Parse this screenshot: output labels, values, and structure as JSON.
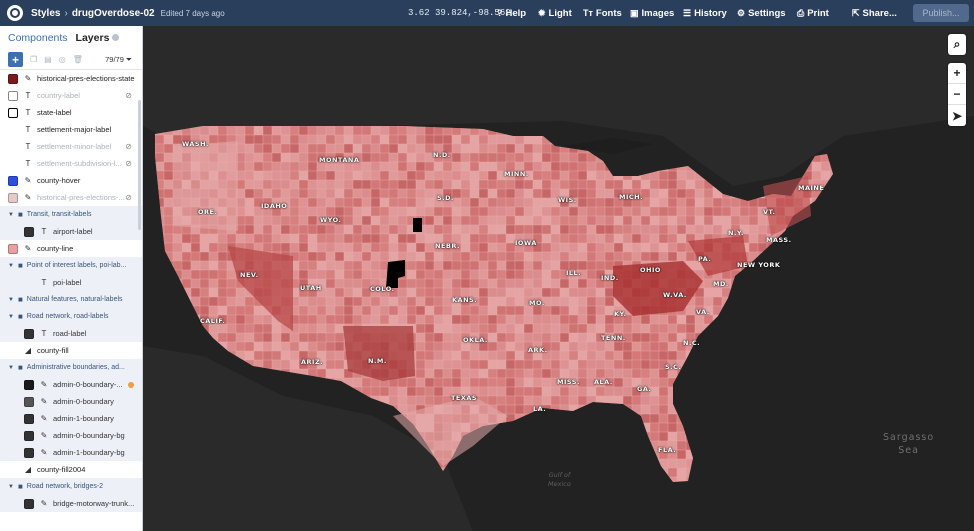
{
  "header": {
    "styles": "Styles",
    "style_name": "drugOverdose-02",
    "edited": "Edited 7 days ago",
    "coords": "3.62 39.824,-98.562",
    "menu": [
      {
        "icon": "help-icon",
        "glyph": "?",
        "label": "Help"
      },
      {
        "icon": "light-icon",
        "glyph": "✹",
        "label": "Light"
      },
      {
        "icon": "fonts-icon",
        "glyph": "Tт",
        "label": "Fonts"
      },
      {
        "icon": "images-icon",
        "glyph": "▣",
        "label": "Images"
      },
      {
        "icon": "history-icon",
        "glyph": "☰",
        "label": "History"
      },
      {
        "icon": "settings-icon",
        "glyph": "⚙",
        "label": "Settings"
      },
      {
        "icon": "print-icon",
        "glyph": "⎙",
        "label": "Print"
      },
      {
        "icon": "share-icon",
        "glyph": "⇱",
        "label": "Share..."
      }
    ],
    "publish": "Publish..."
  },
  "sidebar": {
    "tab_components": "Components",
    "tab_layers": "Layers",
    "count": "79/79",
    "layers": [
      {
        "kind": "layer",
        "swatch": "#7a1a1a",
        "type": "✎",
        "label": "historical-pres-elections-state",
        "dim": false
      },
      {
        "kind": "layer",
        "swatch": "#ffffff",
        "swatch_border": "#888",
        "type": "T",
        "label": "country-label",
        "dim": true,
        "hidden": true
      },
      {
        "kind": "layer",
        "swatch": "#ffffff",
        "swatch_border": "#000",
        "type": "T",
        "label": "state-label",
        "dim": false
      },
      {
        "kind": "layer",
        "swatch": "none",
        "type": "T",
        "label": "settlement-major-label",
        "dim": false
      },
      {
        "kind": "layer",
        "swatch": "none",
        "type": "T",
        "label": "settlement-minor-label",
        "dim": true,
        "hidden": true
      },
      {
        "kind": "layer",
        "swatch": "none",
        "type": "T",
        "label": "settlement-subdivision-l...",
        "dim": true,
        "hidden": true
      },
      {
        "kind": "layer",
        "swatch": "#2d4fe0",
        "type": "✎",
        "label": "county-hover",
        "dim": false
      },
      {
        "kind": "layer",
        "swatch": "#e6c8c8",
        "type": "✎",
        "label": "historical-pres-elections-...",
        "dim": true,
        "hidden": true
      },
      {
        "kind": "group",
        "label": "Transit, transit-labels"
      },
      {
        "kind": "child",
        "swatch": "#333",
        "type": "T",
        "label": "airport-label"
      },
      {
        "kind": "layer",
        "swatch": "#e8a0a0",
        "type": "✎",
        "label": "county-line",
        "dim": false
      },
      {
        "kind": "group",
        "label": "Point of interest labels, poi-lab..."
      },
      {
        "kind": "child",
        "swatch": "none",
        "type": "T",
        "label": "poi-label"
      },
      {
        "kind": "group",
        "label": "Natural features, natural-labels"
      },
      {
        "kind": "group",
        "label": "Road network, road-labels"
      },
      {
        "kind": "child",
        "swatch": "#333",
        "type": "T",
        "label": "road-label"
      },
      {
        "kind": "layer",
        "swatch": "none",
        "type": "◢",
        "label": "county-fill",
        "dim": false
      },
      {
        "kind": "group",
        "label": "Administrative boundaries, ad..."
      },
      {
        "kind": "child",
        "swatch": "#1a1a1a",
        "type": "✎",
        "label": "admin-0-boundary-...",
        "warn": true
      },
      {
        "kind": "child",
        "swatch": "#555",
        "type": "✎",
        "label": "admin-0-boundary"
      },
      {
        "kind": "child",
        "swatch": "#333",
        "type": "✎",
        "label": "admin-1-boundary"
      },
      {
        "kind": "child",
        "swatch": "#333",
        "type": "✎",
        "label": "admin-0-boundary-bg"
      },
      {
        "kind": "child",
        "swatch": "#333",
        "type": "✎",
        "label": "admin-1-boundary-bg"
      },
      {
        "kind": "layer",
        "swatch": "none",
        "type": "◢",
        "label": "county-fill2004",
        "dim": false
      },
      {
        "kind": "group",
        "label": "Road network, bridges-2"
      },
      {
        "kind": "child",
        "swatch": "#333",
        "type": "✎",
        "label": "bridge-motorway-trunk..."
      }
    ]
  },
  "map": {
    "sea_label": [
      "Sargasso",
      "Sea"
    ],
    "gulf_label": [
      "Gulf of",
      "Mexico"
    ],
    "states": [
      {
        "name": "WASH."
      },
      {
        "name": "MONTANA"
      },
      {
        "name": "N.D."
      },
      {
        "name": "MINN."
      },
      {
        "name": "ORE."
      },
      {
        "name": "IDAHO"
      },
      {
        "name": "S.D."
      },
      {
        "name": "WYO."
      },
      {
        "name": "WIS."
      },
      {
        "name": "MICH."
      },
      {
        "name": "MAINE"
      },
      {
        "name": "VT."
      },
      {
        "name": "N.Y."
      },
      {
        "name": "MASS."
      },
      {
        "name": "NEBR."
      },
      {
        "name": "IOWA"
      },
      {
        "name": "NEV."
      },
      {
        "name": "UTAH"
      },
      {
        "name": "COLO."
      },
      {
        "name": "ILL."
      },
      {
        "name": "IND."
      },
      {
        "name": "OHIO"
      },
      {
        "name": "PA."
      },
      {
        "name": "NEW YORK"
      },
      {
        "name": "MD."
      },
      {
        "name": "CALIF."
      },
      {
        "name": "KANS."
      },
      {
        "name": "MO."
      },
      {
        "name": "KY."
      },
      {
        "name": "W.VA."
      },
      {
        "name": "VA."
      },
      {
        "name": "TENN."
      },
      {
        "name": "OKLA."
      },
      {
        "name": "ARK."
      },
      {
        "name": "N.C."
      },
      {
        "name": "ARIZ."
      },
      {
        "name": "N.M."
      },
      {
        "name": "S.C."
      },
      {
        "name": "MISS."
      },
      {
        "name": "ALA."
      },
      {
        "name": "GA."
      },
      {
        "name": "TEXAS"
      },
      {
        "name": "LA."
      },
      {
        "name": "FLA."
      }
    ]
  }
}
